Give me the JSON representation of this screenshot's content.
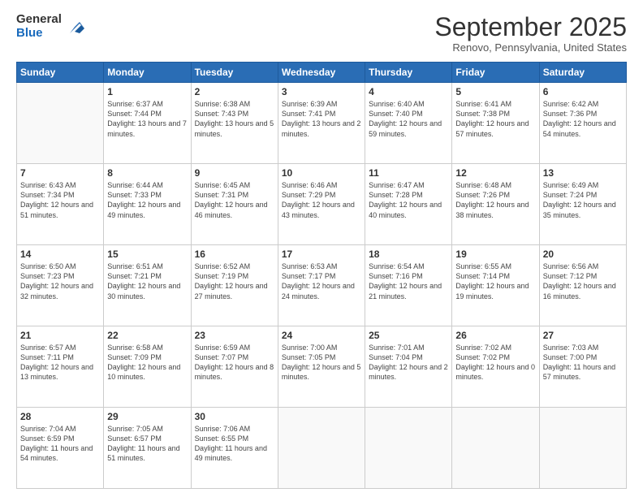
{
  "logo": {
    "general": "General",
    "blue": "Blue"
  },
  "header": {
    "month": "September 2025",
    "location": "Renovo, Pennsylvania, United States"
  },
  "days": [
    "Sunday",
    "Monday",
    "Tuesday",
    "Wednesday",
    "Thursday",
    "Friday",
    "Saturday"
  ],
  "weeks": [
    [
      {
        "day": "",
        "sunrise": "",
        "sunset": "",
        "daylight": ""
      },
      {
        "day": "1",
        "sunrise": "Sunrise: 6:37 AM",
        "sunset": "Sunset: 7:44 PM",
        "daylight": "Daylight: 13 hours and 7 minutes."
      },
      {
        "day": "2",
        "sunrise": "Sunrise: 6:38 AM",
        "sunset": "Sunset: 7:43 PM",
        "daylight": "Daylight: 13 hours and 5 minutes."
      },
      {
        "day": "3",
        "sunrise": "Sunrise: 6:39 AM",
        "sunset": "Sunset: 7:41 PM",
        "daylight": "Daylight: 13 hours and 2 minutes."
      },
      {
        "day": "4",
        "sunrise": "Sunrise: 6:40 AM",
        "sunset": "Sunset: 7:40 PM",
        "daylight": "Daylight: 12 hours and 59 minutes."
      },
      {
        "day": "5",
        "sunrise": "Sunrise: 6:41 AM",
        "sunset": "Sunset: 7:38 PM",
        "daylight": "Daylight: 12 hours and 57 minutes."
      },
      {
        "day": "6",
        "sunrise": "Sunrise: 6:42 AM",
        "sunset": "Sunset: 7:36 PM",
        "daylight": "Daylight: 12 hours and 54 minutes."
      }
    ],
    [
      {
        "day": "7",
        "sunrise": "Sunrise: 6:43 AM",
        "sunset": "Sunset: 7:34 PM",
        "daylight": "Daylight: 12 hours and 51 minutes."
      },
      {
        "day": "8",
        "sunrise": "Sunrise: 6:44 AM",
        "sunset": "Sunset: 7:33 PM",
        "daylight": "Daylight: 12 hours and 49 minutes."
      },
      {
        "day": "9",
        "sunrise": "Sunrise: 6:45 AM",
        "sunset": "Sunset: 7:31 PM",
        "daylight": "Daylight: 12 hours and 46 minutes."
      },
      {
        "day": "10",
        "sunrise": "Sunrise: 6:46 AM",
        "sunset": "Sunset: 7:29 PM",
        "daylight": "Daylight: 12 hours and 43 minutes."
      },
      {
        "day": "11",
        "sunrise": "Sunrise: 6:47 AM",
        "sunset": "Sunset: 7:28 PM",
        "daylight": "Daylight: 12 hours and 40 minutes."
      },
      {
        "day": "12",
        "sunrise": "Sunrise: 6:48 AM",
        "sunset": "Sunset: 7:26 PM",
        "daylight": "Daylight: 12 hours and 38 minutes."
      },
      {
        "day": "13",
        "sunrise": "Sunrise: 6:49 AM",
        "sunset": "Sunset: 7:24 PM",
        "daylight": "Daylight: 12 hours and 35 minutes."
      }
    ],
    [
      {
        "day": "14",
        "sunrise": "Sunrise: 6:50 AM",
        "sunset": "Sunset: 7:23 PM",
        "daylight": "Daylight: 12 hours and 32 minutes."
      },
      {
        "day": "15",
        "sunrise": "Sunrise: 6:51 AM",
        "sunset": "Sunset: 7:21 PM",
        "daylight": "Daylight: 12 hours and 30 minutes."
      },
      {
        "day": "16",
        "sunrise": "Sunrise: 6:52 AM",
        "sunset": "Sunset: 7:19 PM",
        "daylight": "Daylight: 12 hours and 27 minutes."
      },
      {
        "day": "17",
        "sunrise": "Sunrise: 6:53 AM",
        "sunset": "Sunset: 7:17 PM",
        "daylight": "Daylight: 12 hours and 24 minutes."
      },
      {
        "day": "18",
        "sunrise": "Sunrise: 6:54 AM",
        "sunset": "Sunset: 7:16 PM",
        "daylight": "Daylight: 12 hours and 21 minutes."
      },
      {
        "day": "19",
        "sunrise": "Sunrise: 6:55 AM",
        "sunset": "Sunset: 7:14 PM",
        "daylight": "Daylight: 12 hours and 19 minutes."
      },
      {
        "day": "20",
        "sunrise": "Sunrise: 6:56 AM",
        "sunset": "Sunset: 7:12 PM",
        "daylight": "Daylight: 12 hours and 16 minutes."
      }
    ],
    [
      {
        "day": "21",
        "sunrise": "Sunrise: 6:57 AM",
        "sunset": "Sunset: 7:11 PM",
        "daylight": "Daylight: 12 hours and 13 minutes."
      },
      {
        "day": "22",
        "sunrise": "Sunrise: 6:58 AM",
        "sunset": "Sunset: 7:09 PM",
        "daylight": "Daylight: 12 hours and 10 minutes."
      },
      {
        "day": "23",
        "sunrise": "Sunrise: 6:59 AM",
        "sunset": "Sunset: 7:07 PM",
        "daylight": "Daylight: 12 hours and 8 minutes."
      },
      {
        "day": "24",
        "sunrise": "Sunrise: 7:00 AM",
        "sunset": "Sunset: 7:05 PM",
        "daylight": "Daylight: 12 hours and 5 minutes."
      },
      {
        "day": "25",
        "sunrise": "Sunrise: 7:01 AM",
        "sunset": "Sunset: 7:04 PM",
        "daylight": "Daylight: 12 hours and 2 minutes."
      },
      {
        "day": "26",
        "sunrise": "Sunrise: 7:02 AM",
        "sunset": "Sunset: 7:02 PM",
        "daylight": "Daylight: 12 hours and 0 minutes."
      },
      {
        "day": "27",
        "sunrise": "Sunrise: 7:03 AM",
        "sunset": "Sunset: 7:00 PM",
        "daylight": "Daylight: 11 hours and 57 minutes."
      }
    ],
    [
      {
        "day": "28",
        "sunrise": "Sunrise: 7:04 AM",
        "sunset": "Sunset: 6:59 PM",
        "daylight": "Daylight: 11 hours and 54 minutes."
      },
      {
        "day": "29",
        "sunrise": "Sunrise: 7:05 AM",
        "sunset": "Sunset: 6:57 PM",
        "daylight": "Daylight: 11 hours and 51 minutes."
      },
      {
        "day": "30",
        "sunrise": "Sunrise: 7:06 AM",
        "sunset": "Sunset: 6:55 PM",
        "daylight": "Daylight: 11 hours and 49 minutes."
      },
      {
        "day": "",
        "sunrise": "",
        "sunset": "",
        "daylight": ""
      },
      {
        "day": "",
        "sunrise": "",
        "sunset": "",
        "daylight": ""
      },
      {
        "day": "",
        "sunrise": "",
        "sunset": "",
        "daylight": ""
      },
      {
        "day": "",
        "sunrise": "",
        "sunset": "",
        "daylight": ""
      }
    ]
  ]
}
